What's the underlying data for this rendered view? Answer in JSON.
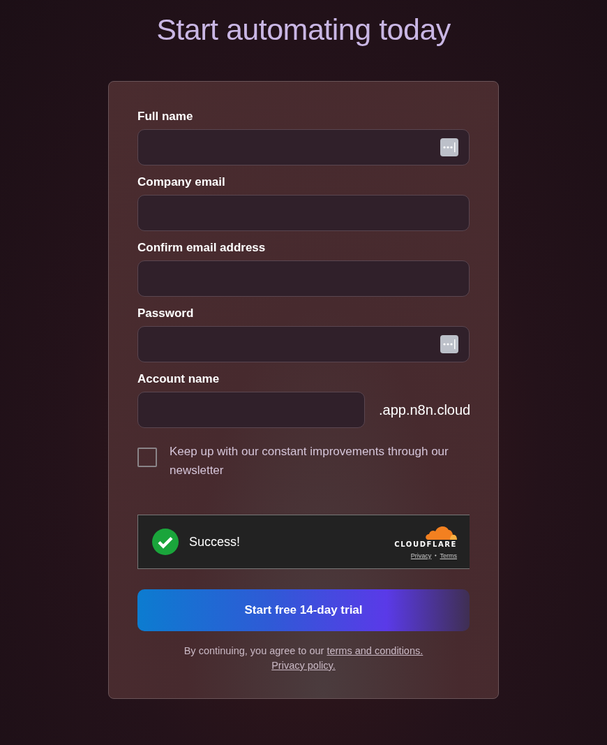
{
  "title": "Start automating today",
  "fields": [
    {
      "label": "Full name",
      "kind": "text",
      "autofill_icon": true
    },
    {
      "label": "Company email",
      "kind": "text",
      "autofill_icon": false
    },
    {
      "label": "Confirm email address",
      "kind": "text",
      "autofill_icon": false
    },
    {
      "label": "Password",
      "kind": "password",
      "autofill_icon": true
    },
    {
      "label": "Account name",
      "kind": "subdomain",
      "autofill_icon": false,
      "suffix": ".app.n8n.cloud"
    }
  ],
  "newsletter": {
    "label": "Keep up with our constant improvements through our newsletter",
    "checked": false
  },
  "captcha": {
    "status": "Success!",
    "brand": "CLOUDFLARE",
    "links": [
      "Privacy",
      "Terms"
    ],
    "separator": "•"
  },
  "submit": "Start free 14-day trial",
  "legal": {
    "text": "By continuing, you agree to our ",
    "terms_link": "terms and conditions.",
    "privacy_link": "Privacy policy."
  }
}
